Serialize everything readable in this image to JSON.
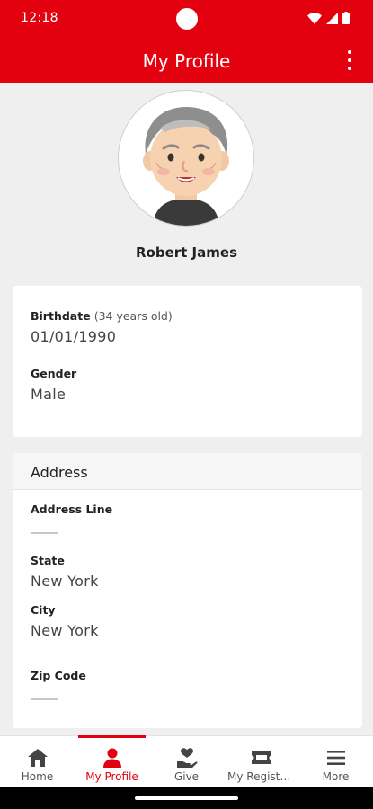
{
  "status_bar": {
    "time": "12:18",
    "icons": [
      "wifi-icon",
      "signal-icon",
      "battery-icon"
    ]
  },
  "app_bar": {
    "title": "My Profile",
    "menu_icon": "more-vert-icon"
  },
  "profile": {
    "name": "Robert James",
    "avatar": "elderly-man-avatar"
  },
  "personal": {
    "birthdate_label": "Birthdate",
    "age_note": "(34 years old)",
    "birthdate_value": "01/01/1990",
    "gender_label": "Gender",
    "gender_value": "Male"
  },
  "address": {
    "header": "Address",
    "line_label": "Address Line",
    "line_value": "",
    "state_label": "State",
    "state_value": "New York",
    "city_label": "City",
    "city_value": "New York",
    "zip_label": "Zip Code",
    "zip_value": ""
  },
  "bottom_nav": {
    "items": [
      {
        "label": "Home",
        "icon": "home-icon"
      },
      {
        "label": "My Profile",
        "icon": "person-icon",
        "active": true
      },
      {
        "label": "Give",
        "icon": "give-hand-heart-icon"
      },
      {
        "label": "My Registra...",
        "icon": "ticket-icon"
      },
      {
        "label": "More",
        "icon": "menu-icon"
      }
    ]
  },
  "colors": {
    "brand_red": "#e3000f",
    "background": "#efefef",
    "nav_inactive": "#444444"
  }
}
